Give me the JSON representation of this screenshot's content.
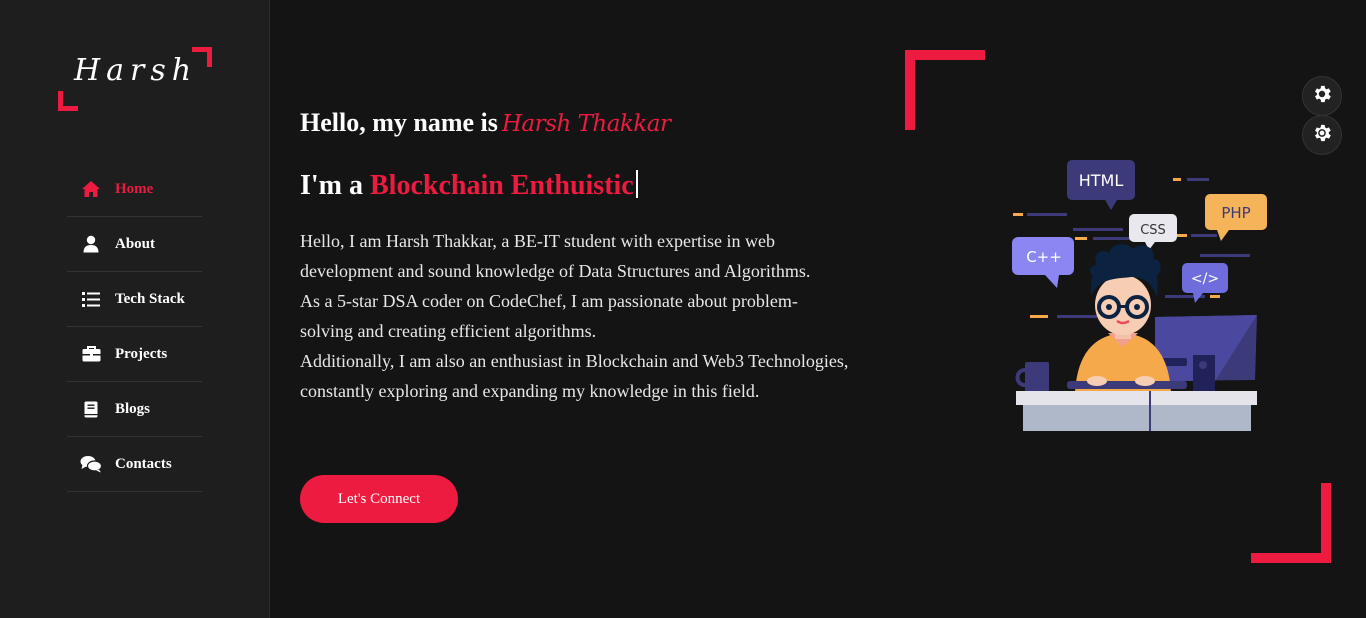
{
  "logo": {
    "text": "Harsh"
  },
  "nav": {
    "items": [
      {
        "label": "Home",
        "icon": "home-icon",
        "active": true
      },
      {
        "label": "About",
        "icon": "user-icon"
      },
      {
        "label": "Tech Stack",
        "icon": "list-icon"
      },
      {
        "label": "Projects",
        "icon": "briefcase-icon"
      },
      {
        "label": "Blogs",
        "icon": "book-icon"
      },
      {
        "label": "Contacts",
        "icon": "comments-icon"
      }
    ]
  },
  "hero": {
    "greeting": "Hello, my name is",
    "name": "Harsh Thakkar",
    "role_prefix": "I'm a",
    "role": "Blockchain Enthuistic",
    "bio": [
      "Hello, I am Harsh Thakkar, a BE-IT student with expertise in web",
      "development and sound knowledge of Data Structures and Algorithms.",
      "As a 5-star DSA coder on CodeChef, I am passionate about problem-",
      "solving and creating efficient algorithms.",
      "Additionally, I am also an enthusiast in Blockchain and Web3 Technologies,",
      "constantly exploring and expanding my knowledge in this field."
    ],
    "cta_label": "Let's Connect"
  },
  "illustration": {
    "bubbles": [
      "HTML",
      "CSS",
      "PHP",
      "C++",
      "</>"
    ]
  },
  "colors": {
    "accent": "#ed1b40",
    "sidebar": "#1e1e1e",
    "background": "#141414"
  }
}
